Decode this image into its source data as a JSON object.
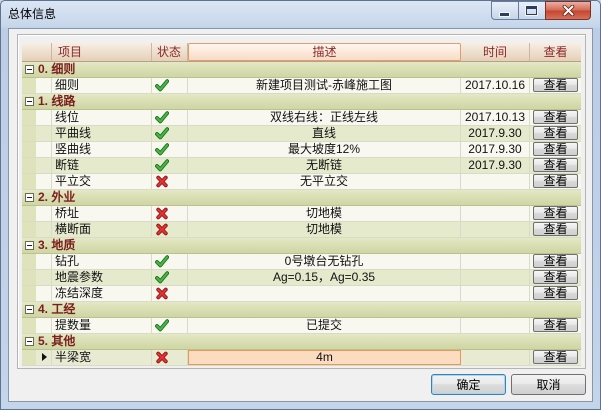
{
  "window": {
    "title": "总体信息"
  },
  "grid": {
    "columns": [
      {
        "label": "项目"
      },
      {
        "label": "状态"
      },
      {
        "label": "描述",
        "hot": true
      },
      {
        "label": "时间"
      },
      {
        "label": "查看"
      }
    ],
    "groups": [
      {
        "label": "0. 细则",
        "expanded": true,
        "rows": [
          {
            "item": "细则",
            "status": "check-icon",
            "desc": "新建项目测试-赤峰施工图",
            "time": "2017.10.16",
            "view": "查看"
          }
        ]
      },
      {
        "label": "1. 线路",
        "expanded": true,
        "rows": [
          {
            "item": "线位",
            "status": "check-icon",
            "desc": "双线右线：正线左线",
            "time": "2017.10.13",
            "view": "查看"
          },
          {
            "item": "平曲线",
            "status": "check-icon",
            "desc": "直线",
            "time": "2017.9.30",
            "view": "查看"
          },
          {
            "item": "竖曲线",
            "status": "check-icon",
            "desc": "最大坡度12%",
            "time": "2017.9.30",
            "view": "查看"
          },
          {
            "item": "断链",
            "status": "check-icon",
            "desc": "无断链",
            "time": "2017.9.30",
            "view": "查看"
          },
          {
            "item": "平立交",
            "status": "cross-icon",
            "desc": "无平立交",
            "time": "",
            "view": "查看"
          }
        ]
      },
      {
        "label": "2. 外业",
        "expanded": true,
        "rows": [
          {
            "item": "桥址",
            "status": "cross-icon",
            "desc": "切地模",
            "time": "",
            "view": "查看"
          },
          {
            "item": "横断面",
            "status": "cross-icon",
            "desc": "切地模",
            "time": "",
            "view": "查看"
          }
        ]
      },
      {
        "label": "3. 地质",
        "expanded": true,
        "rows": [
          {
            "item": "钻孔",
            "status": "check-icon",
            "desc": "0号墩台无钻孔",
            "time": "",
            "view": "查看"
          },
          {
            "item": "地震参数",
            "status": "check-icon",
            "desc": "Ag=0.15，Ag=0.35",
            "time": "",
            "view": "查看"
          },
          {
            "item": "冻结深度",
            "status": "cross-icon",
            "desc": "",
            "time": "",
            "view": "查看"
          }
        ]
      },
      {
        "label": "4. 工经",
        "expanded": true,
        "rows": [
          {
            "item": "提数量",
            "status": "check-icon",
            "desc": "已提交",
            "time": "",
            "view": "查看"
          }
        ]
      },
      {
        "label": "5. 其他",
        "expanded": true,
        "rows": [
          {
            "item": "半梁宽",
            "status": "cross-icon",
            "desc": "4m",
            "time": "",
            "view": "查看",
            "selected": true
          }
        ]
      }
    ]
  },
  "icons": {
    "check-icon": {
      "outline": "#1d6a1d",
      "fill": "#43b843"
    },
    "cross-icon": {
      "outline": "#8e1212",
      "fill": "#e53131"
    }
  },
  "buttons": {
    "ok": "确定",
    "cancel": "取消"
  }
}
